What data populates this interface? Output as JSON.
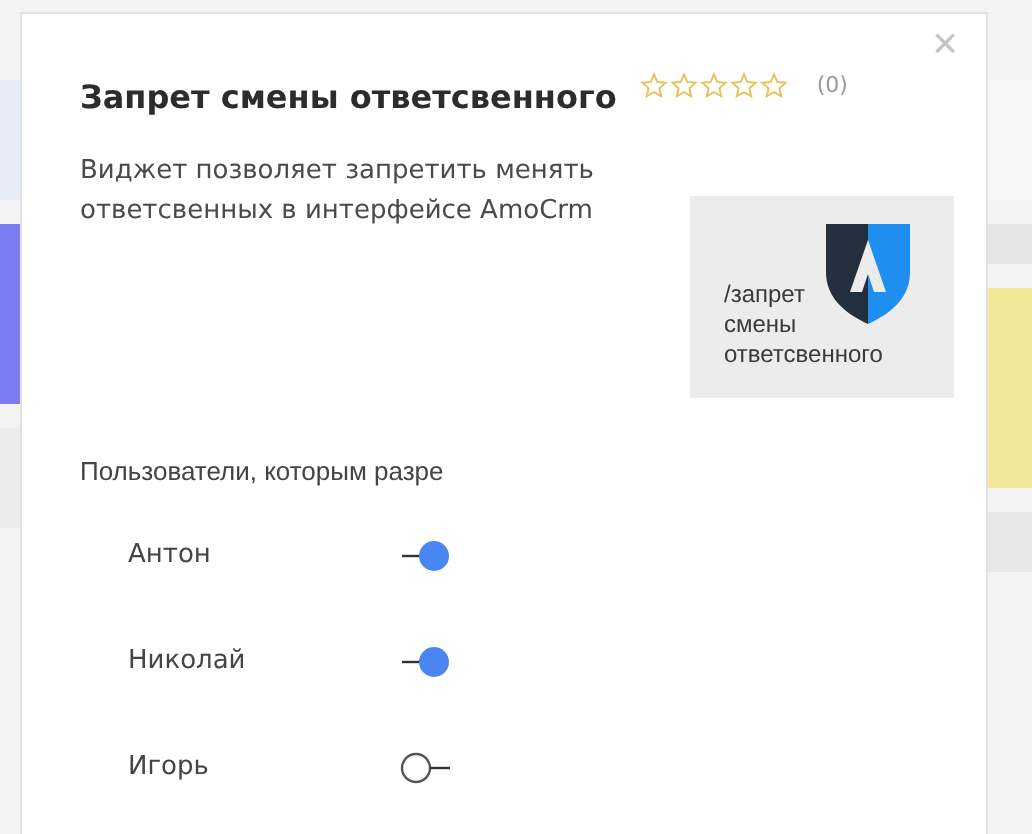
{
  "dialog": {
    "title": "Запрет смены ответсвенного",
    "stars": 0,
    "rating_count": "(0)",
    "close": "×",
    "description": "Виджет позволяет запретить менять ответсвенных в интерфейсе AmoCrm",
    "logo_caption": [
      "/запрет",
      "смены",
      "ответсвенного"
    ],
    "users_label": "Пользователи, которым разре",
    "users": [
      {
        "name": "Антон",
        "on": true
      },
      {
        "name": "Николай",
        "on": true
      },
      {
        "name": "Игорь",
        "on": false
      }
    ]
  }
}
